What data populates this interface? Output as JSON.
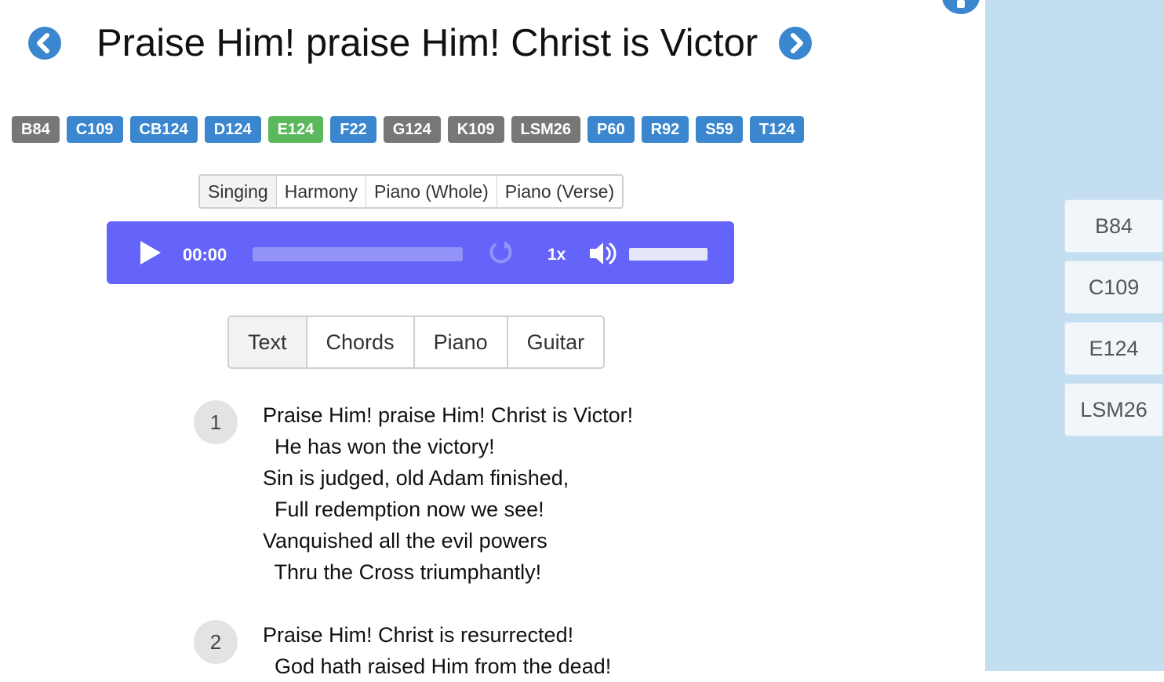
{
  "header": {
    "title": "Praise Him! praise Him! Christ is Victor"
  },
  "badges": [
    {
      "label": "B84",
      "color": "gray"
    },
    {
      "label": "C109",
      "color": "blue"
    },
    {
      "label": "CB124",
      "color": "blue"
    },
    {
      "label": "D124",
      "color": "blue"
    },
    {
      "label": "E124",
      "color": "green"
    },
    {
      "label": "F22",
      "color": "blue"
    },
    {
      "label": "G124",
      "color": "gray"
    },
    {
      "label": "K109",
      "color": "gray"
    },
    {
      "label": "LSM26",
      "color": "gray"
    },
    {
      "label": "P60",
      "color": "blue"
    },
    {
      "label": "R92",
      "color": "blue"
    },
    {
      "label": "S59",
      "color": "blue"
    },
    {
      "label": "T124",
      "color": "blue"
    }
  ],
  "audio_tabs": [
    "Singing",
    "Harmony",
    "Piano (Whole)",
    "Piano (Verse)"
  ],
  "player": {
    "time": "00:00",
    "speed": "1x",
    "progress": 0,
    "accent_color": "#6464fa"
  },
  "view_tabs": [
    "Text",
    "Chords",
    "Piano",
    "Guitar"
  ],
  "verses": [
    {
      "number": "1",
      "lines": [
        "Praise Him! praise Him! Christ is Victor!",
        "  He has won the victory!",
        "Sin is judged, old Adam finished,",
        "  Full redemption now we see!",
        "Vanquished all the evil powers",
        "  Thru the Cross triumphantly!"
      ]
    },
    {
      "number": "2",
      "lines": [
        "Praise Him! Christ is resurrected!",
        "  God hath raised Him from the dead!"
      ]
    }
  ],
  "sidebar": {
    "items": [
      "B84",
      "C109",
      "E124",
      "LSM26"
    ]
  },
  "colors": {
    "brand_blue": "#3a86cf",
    "badge_gray": "#777777",
    "badge_green": "#5cb85c",
    "sidebar_bg": "#c2def0"
  }
}
